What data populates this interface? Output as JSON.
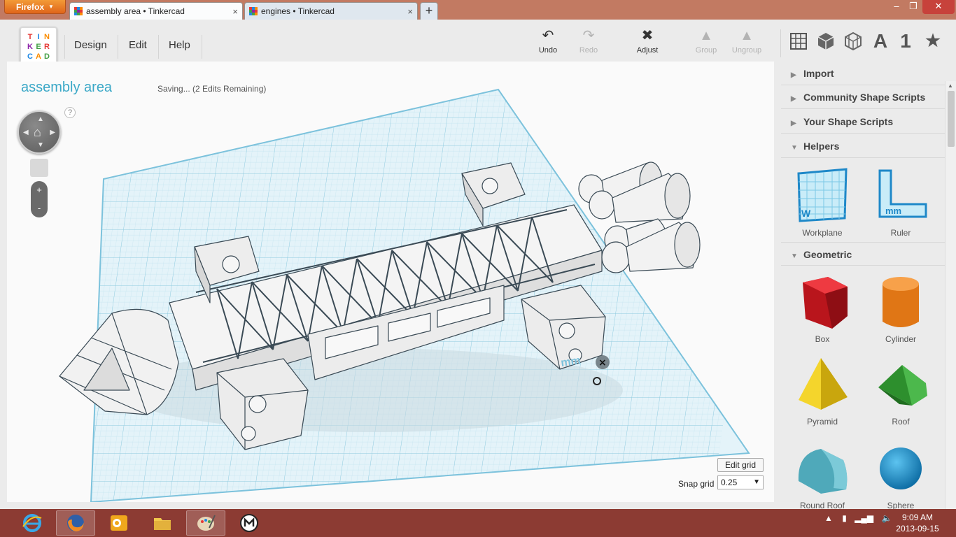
{
  "browser": {
    "menu_label": "Firefox",
    "tabs": [
      {
        "title": "assembly area • Tinkercad",
        "active": true
      },
      {
        "title": "engines • Tinkercad",
        "active": false
      }
    ],
    "new_tab": "+",
    "window_controls": {
      "minimize": "–",
      "restore": "❐",
      "close": "✕"
    }
  },
  "logo": {
    "letters": [
      "T",
      "I",
      "N",
      "K",
      "E",
      "R",
      "C",
      "A",
      "D"
    ],
    "colors": [
      "#e53935",
      "#1e88e5",
      "#fb8c00",
      "#8e24aa",
      "#43a047",
      "#e53935",
      "#1e88e5",
      "#fb8c00",
      "#43a047"
    ]
  },
  "menu": {
    "design": "Design",
    "edit": "Edit",
    "help": "Help"
  },
  "toolbar": {
    "undo": "Undo",
    "redo": "Redo",
    "adjust": "Adjust",
    "group": "Group",
    "ungroup": "Ungroup"
  },
  "view_buttons": {
    "text_label": "A",
    "number_label": "1",
    "star_label": "★"
  },
  "design": {
    "title": "assembly area",
    "status": "Saving... (2 Edits Remaining)"
  },
  "navigation": {
    "help": "?",
    "zoom_in": "+",
    "zoom_out": "-"
  },
  "grid": {
    "edit_label": "Edit grid",
    "snap_label": "Snap grid",
    "snap_value": "0.25"
  },
  "workplane": {
    "unit_label": "mm"
  },
  "panel": {
    "sections": [
      {
        "label": "Import",
        "expanded": false
      },
      {
        "label": "Community Shape Scripts",
        "expanded": false
      },
      {
        "label": "Your Shape Scripts",
        "expanded": false
      },
      {
        "label": "Helpers",
        "expanded": true
      },
      {
        "label": "Geometric",
        "expanded": true
      }
    ],
    "helpers": [
      {
        "label": "Workplane",
        "glyph": "W"
      },
      {
        "label": "Ruler",
        "glyph": "mm"
      }
    ],
    "shapes": [
      {
        "label": "Box",
        "color": "#d42027"
      },
      {
        "label": "Cylinder",
        "color": "#e8801e"
      },
      {
        "label": "Pyramid",
        "color": "#f0cd1a"
      },
      {
        "label": "Roof",
        "color": "#3aa23a"
      },
      {
        "label": "Round Roof",
        "color": "#5ab8c8"
      },
      {
        "label": "Sphere",
        "color": "#1f8ec7"
      }
    ]
  },
  "taskbar": {
    "time": "9:09 AM",
    "date": "2013-09-15"
  }
}
